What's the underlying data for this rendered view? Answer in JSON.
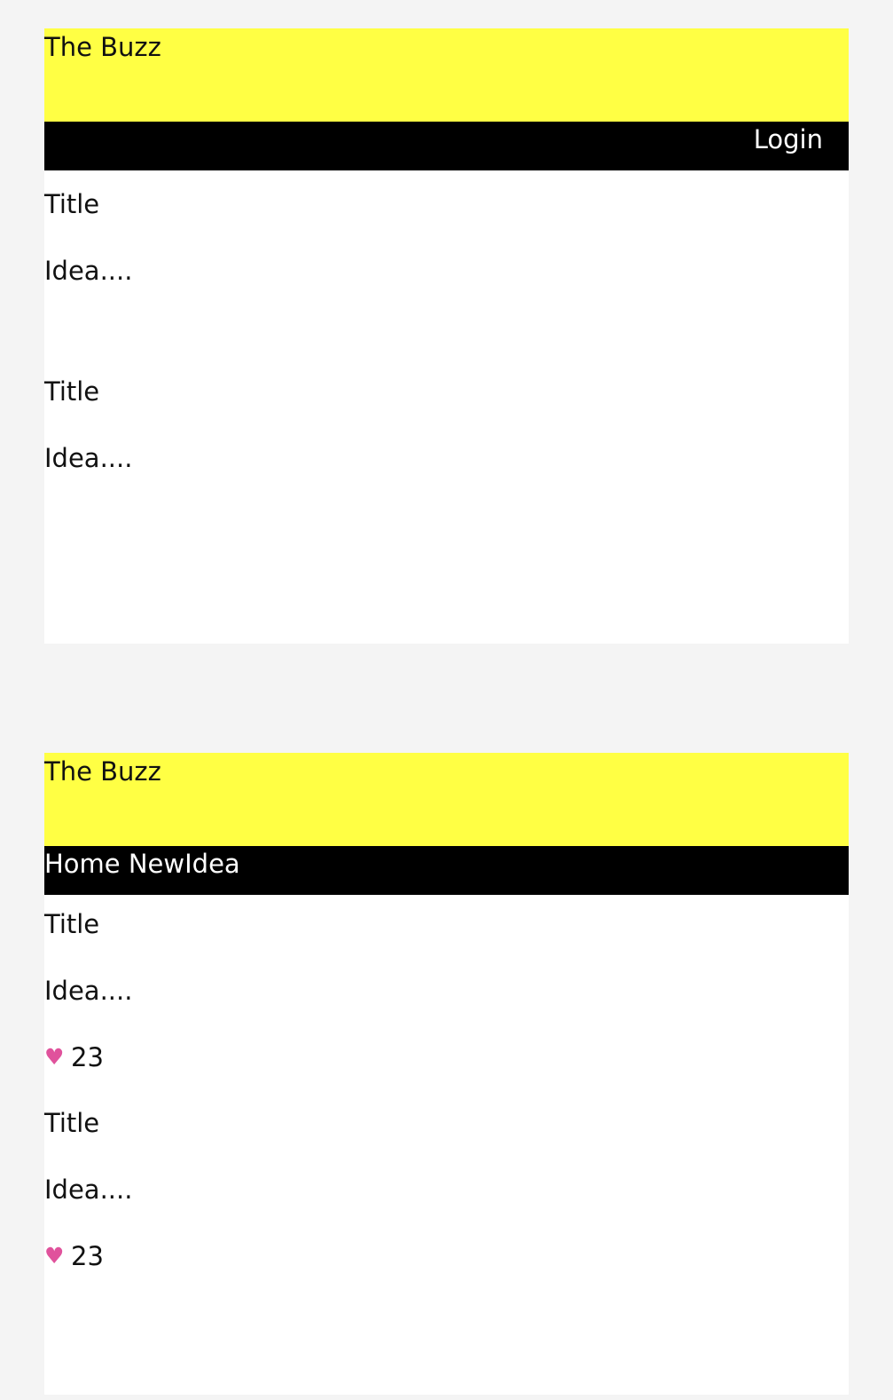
{
  "logged_out_view": {
    "header": {
      "title": "The Buzz"
    },
    "nav": {
      "login_label": "Login"
    },
    "posts": [
      {
        "title": "Title",
        "idea": "Idea...."
      },
      {
        "title": "Title",
        "idea": "Idea...."
      }
    ]
  },
  "logged_in_view": {
    "header": {
      "title": "The Buzz"
    },
    "nav": {
      "home_label": "Home",
      "new_idea_label": "NewIdea"
    },
    "posts": [
      {
        "title": "Title",
        "idea": "Idea....",
        "likes": "23",
        "like_icon": "heart-icon"
      },
      {
        "title": "Title",
        "idea": "Idea....",
        "likes": "23",
        "like_icon": "heart-icon"
      }
    ]
  },
  "colors": {
    "header_bg": "#ffff44",
    "nav_bg": "#000000",
    "heart": "#e0529c"
  }
}
